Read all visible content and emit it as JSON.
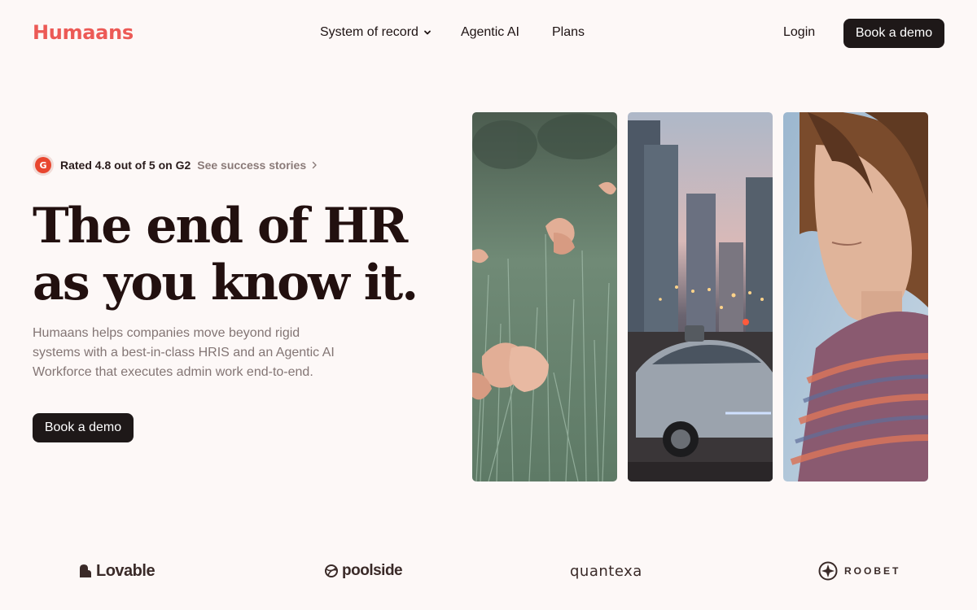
{
  "header": {
    "logo": "Humaans",
    "nav": [
      {
        "label": "System of record",
        "has_dropdown": true
      },
      {
        "label": "Agentic AI"
      },
      {
        "label": "Plans"
      }
    ],
    "login": "Login",
    "cta": "Book a demo"
  },
  "hero": {
    "rating_icon": "G",
    "rating_text": "Rated 4.8 out of 5 on G2",
    "rating_link": "See success stories",
    "headline_line1": "The end of HR",
    "headline_line2": "as you know it.",
    "subtext": "Humaans helps companies move beyond rigid systems with a best-in-class HRIS and an Agentic AI Workforce that executes admin work end-to-end.",
    "cta": "Book a demo"
  },
  "images": [
    {
      "name": "poppy-meadow-photo"
    },
    {
      "name": "autonomous-car-city-photo"
    },
    {
      "name": "woman-portrait-photo"
    }
  ],
  "logos": [
    "Lovable",
    "poolside",
    "quantexa",
    "ROOBET"
  ],
  "colors": {
    "background": "#fdf8f7",
    "brand": "#ec5a56",
    "button": "#1e1818",
    "headline": "#22100f",
    "muted": "#837574"
  }
}
